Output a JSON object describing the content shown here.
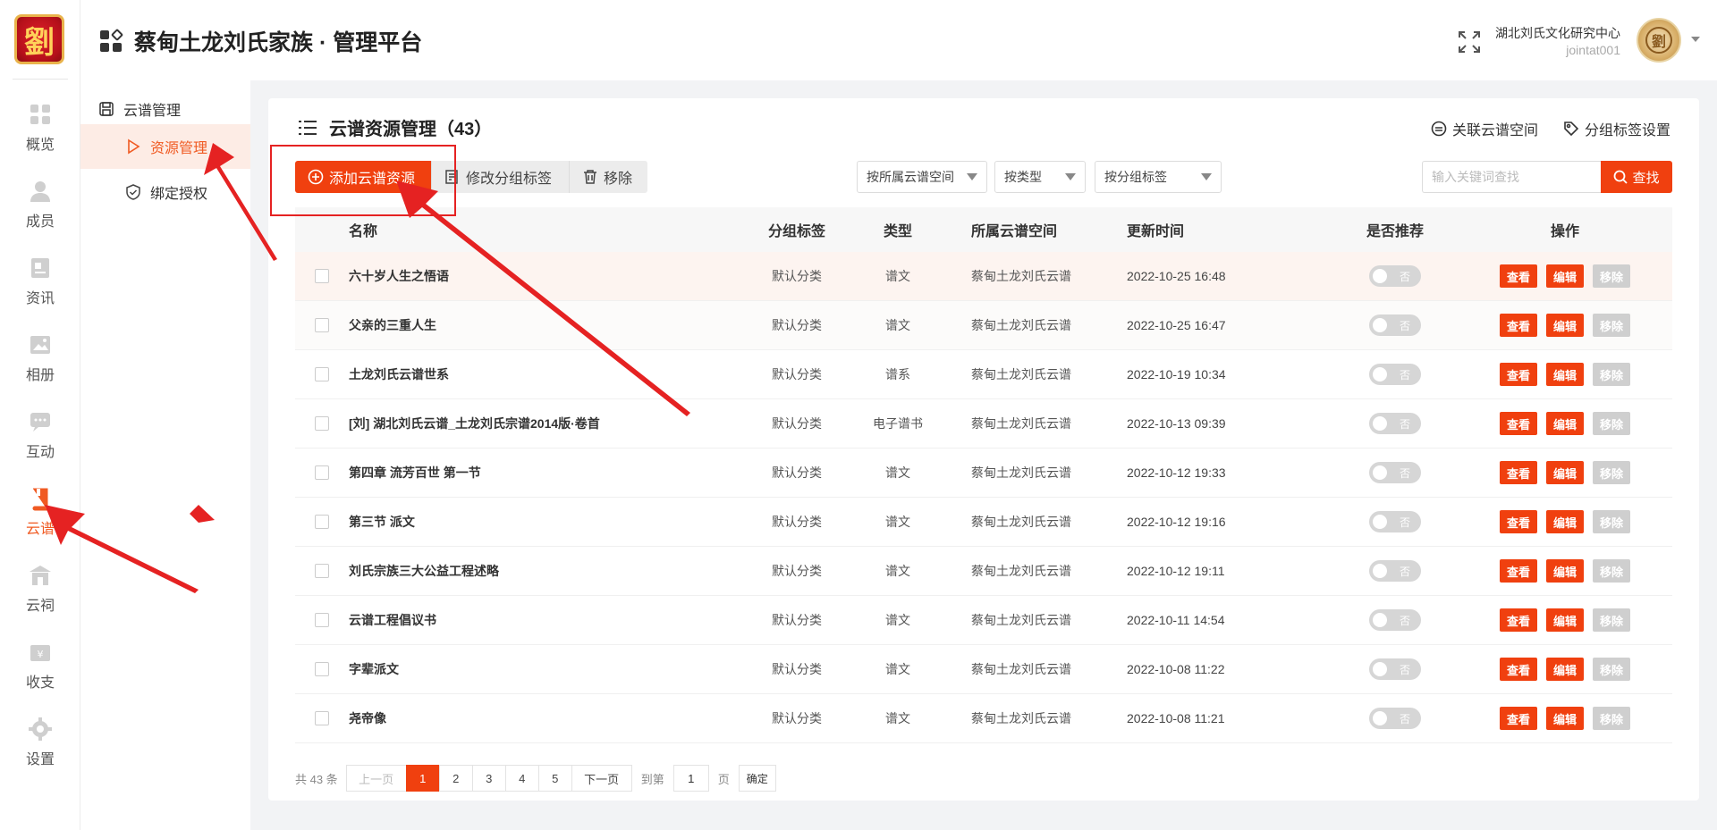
{
  "rail": {
    "logo_char": "劉",
    "items": [
      {
        "label": "概览",
        "icon": "overview-icon"
      },
      {
        "label": "成员",
        "icon": "member-icon"
      },
      {
        "label": "资讯",
        "icon": "news-icon"
      },
      {
        "label": "相册",
        "icon": "album-icon"
      },
      {
        "label": "互动",
        "icon": "chat-icon"
      },
      {
        "label": "云谱",
        "icon": "book-icon",
        "active": true
      },
      {
        "label": "云祠",
        "icon": "temple-icon"
      },
      {
        "label": "收支",
        "icon": "finance-icon"
      },
      {
        "label": "设置",
        "icon": "gear-icon"
      }
    ]
  },
  "header": {
    "title": "蔡甸土龙刘氏家族 · 管理平台",
    "org_name": "湖北刘氏文化研究中心",
    "user_id": "jointat001",
    "avatar_char": "劉"
  },
  "subnav": {
    "group_label": "云谱管理",
    "items": [
      {
        "label": "资源管理",
        "active": true
      },
      {
        "label": "绑定授权"
      }
    ]
  },
  "card": {
    "title": "云谱资源管理（43）",
    "link_space": "关联云谱空间",
    "link_tags": "分组标签设置",
    "btn_add": "添加云谱资源",
    "btn_edit_tag": "修改分组标签",
    "btn_remove": "移除",
    "filter_space": "按所属云谱空间",
    "filter_type": "按类型",
    "filter_tag": "按分组标签",
    "search_placeholder": "输入关键词查找",
    "search_btn": "查找"
  },
  "table": {
    "headers": {
      "name": "名称",
      "tag": "分组标签",
      "type": "类型",
      "space": "所属云谱空间",
      "time": "更新时间",
      "recommend": "是否推荐",
      "ops": "操作"
    },
    "op_view": "查看",
    "op_edit": "编辑",
    "op_remove": "移除",
    "switch_off": "否",
    "rows": [
      {
        "name": "六十岁人生之悟语",
        "tag": "默认分类",
        "type": "谱文",
        "space": "蔡甸土龙刘氏云谱",
        "time": "2022-10-25 16:48"
      },
      {
        "name": "父亲的三重人生",
        "tag": "默认分类",
        "type": "谱文",
        "space": "蔡甸土龙刘氏云谱",
        "time": "2022-10-25 16:47"
      },
      {
        "name": "土龙刘氏云谱世系",
        "tag": "默认分类",
        "type": "谱系",
        "space": "蔡甸土龙刘氏云谱",
        "time": "2022-10-19 10:34"
      },
      {
        "name": "[刘] 湖北刘氏云谱_土龙刘氏宗谱2014版·卷首",
        "tag": "默认分类",
        "type": "电子谱书",
        "space": "蔡甸土龙刘氏云谱",
        "time": "2022-10-13 09:39"
      },
      {
        "name": "第四章 流芳百世 第一节",
        "tag": "默认分类",
        "type": "谱文",
        "space": "蔡甸土龙刘氏云谱",
        "time": "2022-10-12 19:33"
      },
      {
        "name": "第三节 派文",
        "tag": "默认分类",
        "type": "谱文",
        "space": "蔡甸土龙刘氏云谱",
        "time": "2022-10-12 19:16"
      },
      {
        "name": "刘氏宗族三大公益工程述略",
        "tag": "默认分类",
        "type": "谱文",
        "space": "蔡甸土龙刘氏云谱",
        "time": "2022-10-12 19:11"
      },
      {
        "name": "云谱工程倡议书",
        "tag": "默认分类",
        "type": "谱文",
        "space": "蔡甸土龙刘氏云谱",
        "time": "2022-10-11 14:54"
      },
      {
        "name": "字辈派文",
        "tag": "默认分类",
        "type": "谱文",
        "space": "蔡甸土龙刘氏云谱",
        "time": "2022-10-08 11:22"
      },
      {
        "name": "尧帝像",
        "tag": "默认分类",
        "type": "谱文",
        "space": "蔡甸土龙刘氏云谱",
        "time": "2022-10-08 11:21"
      }
    ]
  },
  "pager": {
    "total": "共 43 条",
    "prev": "上一页",
    "pages": [
      "1",
      "2",
      "3",
      "4",
      "5"
    ],
    "next": "下一页",
    "goto_label": "到第",
    "goto_value": "1",
    "page_unit": "页",
    "confirm": "确定"
  },
  "colors": {
    "accent": "#f0400f",
    "annotation": "#e52222"
  }
}
